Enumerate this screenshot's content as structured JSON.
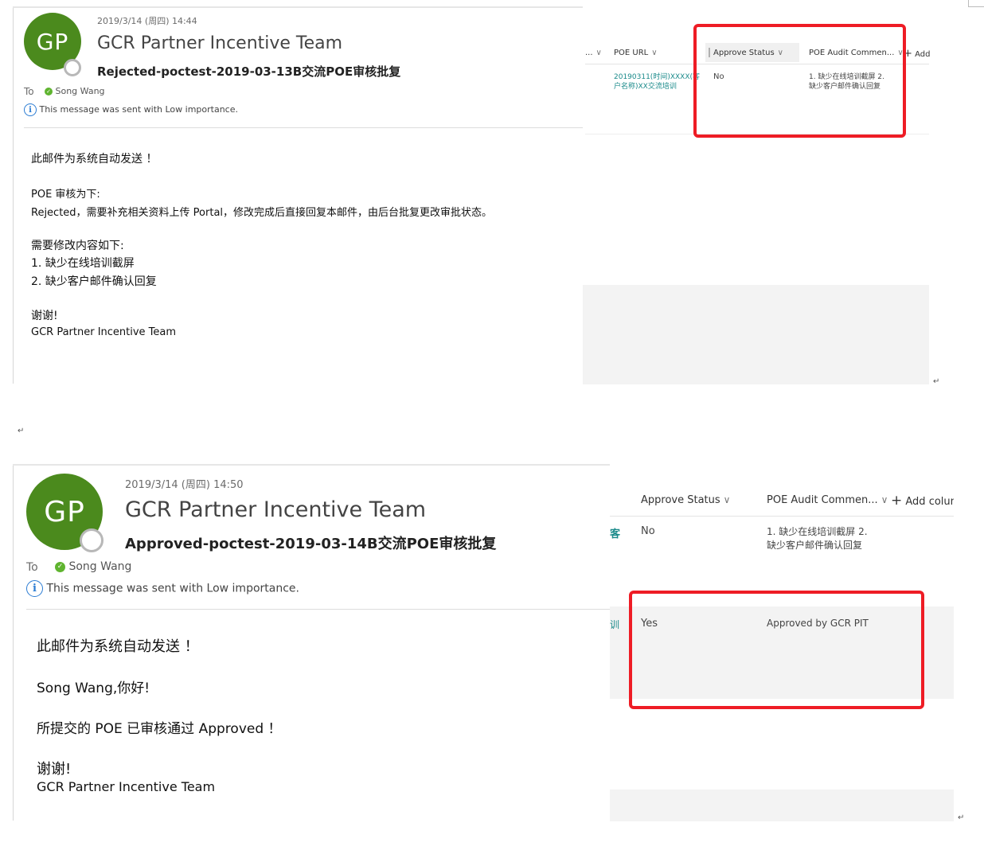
{
  "email1": {
    "datetime": "2019/3/14 (周四) 14:44",
    "avatar_initials": "GP",
    "sender": "GCR Partner Incentive Team",
    "subject": "Rejected-poctest-2019-03-13B交流POE审核批复",
    "to_label": "To",
    "recipient": "Song Wang",
    "importance_note": "This message was sent with Low importance.",
    "body": [
      "此邮件为系统自动发送 ！",
      "POE 审核为下:",
      "Rejected，需要补充相关资料上传 Portal，修改完成后直接回复本邮件，由后台批复更改审批状态。",
      "需要修改内容如下:",
      "1.  缺少在线培训截屏",
      "2.  缺少客户邮件确认回复",
      "谢谢!",
      "GCR Partner Incentive Team"
    ]
  },
  "list1": {
    "col_prev_partial": "...",
    "col_poe_url": "POE URL",
    "col_approve_status": "Approve Status",
    "col_audit_comment": "POE Audit Commen...",
    "add_button": "Add",
    "row": {
      "poe_url_line1": "20190311(时间)XXXX(客",
      "poe_url_line2": "户名称)XX交流培训",
      "approve_status": "No",
      "comment_line1": "1. 缺少在线培训截屏 2.",
      "comment_line2": "缺少客户邮件确认回复"
    }
  },
  "email2": {
    "datetime": "2019/3/14 (周四) 14:50",
    "avatar_initials": "GP",
    "sender": "GCR Partner Incentive Team",
    "subject": "Approved-poctest-2019-03-14B交流POE审核批复",
    "to_label": "To",
    "recipient": "Song Wang",
    "importance_note": "This message was sent with Low importance.",
    "body": [
      "此邮件为系统自动发送 ！",
      "Song Wang,你好!",
      "所提交的 POE 已审核通过 Approved ！",
      "谢谢!",
      "GCR Partner Incentive Team"
    ]
  },
  "list2": {
    "col_approve_status": "Approve Status",
    "col_audit_comment": "POE Audit Commen...",
    "add_button": "Add colum",
    "rows": [
      {
        "partial_char": "客",
        "approve_status": "No",
        "comment_line1": "1. 缺少在线培训截屏 2.",
        "comment_line2": "缺少客户邮件确认回复"
      },
      {
        "partial_char": "训",
        "approve_status": "Yes",
        "comment_line1": "Approved by GCR PIT",
        "comment_line2": ""
      }
    ]
  },
  "marks": {
    "enter": "↵"
  },
  "colors": {
    "avatar": "#4b8a1d",
    "highlight_box": "#ee1c25",
    "link": "#1a8a8a",
    "online_check": "#5fb42f",
    "info_icon": "#2b7cd3"
  }
}
